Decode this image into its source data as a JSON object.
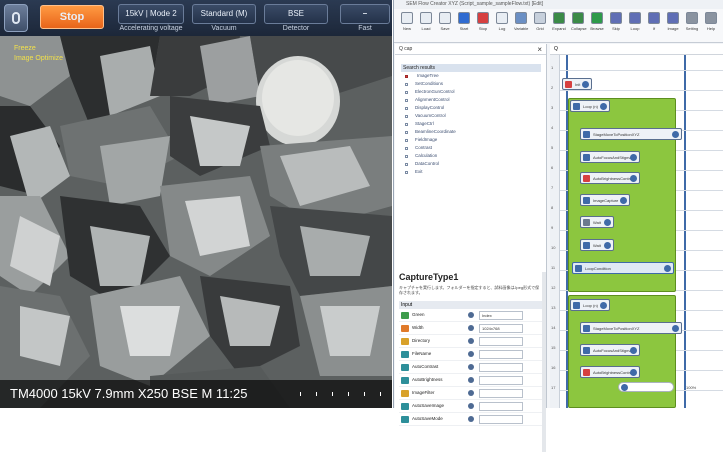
{
  "sem": {
    "stop_label": "Stop",
    "accel": {
      "value": "15kV | Mode 2",
      "caption": "Accelerating voltage"
    },
    "vacuum": {
      "value": "Standard (M)",
      "caption": "Vacuum"
    },
    "detector": {
      "value": "BSE",
      "caption": "Detector"
    },
    "scan": {
      "value": "–",
      "caption": "Fast"
    },
    "overlay_freeze": "Freeze",
    "overlay_optimize": "Image Optimize",
    "status": "TM4000 15kV 7.9mm X250 BSE M 11:25"
  },
  "flow": {
    "window_title": "SEM Flow Creator  XYZ  (Script_sample_sampleFlow.txt) [Edit]",
    "ribbon": [
      {
        "label": "New",
        "icon": "new-file-icon",
        "color": "#e8edf3"
      },
      {
        "label": "Load",
        "icon": "open-icon",
        "color": "#e8edf3"
      },
      {
        "label": "Save",
        "icon": "save-icon",
        "color": "#e8edf3"
      },
      {
        "label": "Start",
        "icon": "play-icon",
        "color": "#2f6bd1"
      },
      {
        "label": "Stop",
        "icon": "stop-icon",
        "color": "#d64040"
      },
      {
        "label": "Log",
        "icon": "log-icon",
        "color": "#e8edf3"
      },
      {
        "label": "Variable",
        "icon": "variable-icon",
        "color": "#6b8fc4"
      },
      {
        "label": "Grid",
        "icon": "grid-icon",
        "color": "#c7d0dc"
      },
      {
        "label": "Expand",
        "icon": "expand-icon",
        "color": "#3b8a47"
      },
      {
        "label": "Collapse",
        "icon": "collapse-icon",
        "color": "#3b8a47"
      },
      {
        "label": "Browse",
        "icon": "browse-icon",
        "color": "#2e9a4a"
      },
      {
        "label": "Skip",
        "icon": "skip-icon",
        "color": "#5f6eb5"
      },
      {
        "label": "Loop",
        "icon": "loop-icon",
        "color": "#5f6eb5"
      },
      {
        "label": "If",
        "icon": "if-icon",
        "color": "#5f6eb5"
      },
      {
        "label": "Image",
        "icon": "image-icon",
        "color": "#5f6eb5"
      },
      {
        "label": "Setting",
        "icon": "gear-icon",
        "color": "#8a93a0"
      },
      {
        "label": "Help",
        "icon": "help-icon",
        "color": "#8a93a0"
      }
    ],
    "search_text": "Q cap",
    "tree_head": "Search results",
    "tree_items": [
      "ImageTree",
      "SetConditions",
      "ElectronGunControl",
      "AlignmentControl",
      "DisplayControl",
      "VacuumControl",
      "StageCtrl",
      "BeamlineCoordinate",
      "FieldImage",
      "Contrast",
      "Calculation",
      "DataControl",
      "Exit"
    ],
    "props": {
      "title": "CaptureType1",
      "desc": "キャプチャを実行します。フォルダーを指定すると、試料画像はJpeg形式で保存されます。",
      "input_head": "Input",
      "rows": [
        {
          "label": "Green",
          "value": "Index",
          "color": "#3d9c4b"
        },
        {
          "label": "Width",
          "value": "1024x768",
          "color": "#e07a2a"
        },
        {
          "label": "Directory",
          "value": "",
          "color": "#d8a12a"
        },
        {
          "label": "FileName",
          "value": "",
          "color": "#2d8f9a"
        },
        {
          "label": "AutoContrast",
          "value": "",
          "color": "#2d8f9a"
        },
        {
          "label": "AutoBrightness",
          "value": "",
          "color": "#2d8f9a"
        },
        {
          "label": "ImageFilter",
          "value": "",
          "color": "#d8a12a"
        },
        {
          "label": "AutoSaveImage",
          "value": "",
          "color": "#2d8f9a"
        },
        {
          "label": "AutoSaveMode",
          "value": "",
          "color": "#2d8f9a"
        }
      ]
    },
    "canvas_search": "Q",
    "ruler_numbers": [
      "1",
      "2",
      "3",
      "4",
      "5",
      "6",
      "7",
      "8",
      "9",
      "10",
      "11",
      "12",
      "13",
      "14",
      "15",
      "16",
      "17"
    ],
    "nodes": [
      {
        "label": "Init",
        "color": "#d64040"
      },
      {
        "label": "Loop (n)",
        "color": "#3f6aa8"
      },
      {
        "label": "StageMoveToPositionXYZ",
        "color": "#3f6aa8"
      },
      {
        "label": "AutoFocusAndStigma",
        "color": "#3f6aa8"
      },
      {
        "label": "AutoBrightnessContrast",
        "color": "#d64040"
      },
      {
        "label": "ImageCapture",
        "color": "#3f6aa8"
      },
      {
        "label": "Wait",
        "color": "#6b7a8f"
      },
      {
        "label": "Wait",
        "color": "#3f6aa8"
      },
      {
        "label": "LoopCondition",
        "color": "#3f6aa8"
      },
      {
        "label": "Loop (n)",
        "color": "#3f6aa8"
      },
      {
        "label": "StageMoveToPositionXYZ",
        "color": "#3f6aa8"
      },
      {
        "label": "AutoFocusAndStigma",
        "color": "#3f6aa8"
      },
      {
        "label": "AutoBrightnessContrast",
        "color": "#d64040"
      }
    ],
    "zoom_label": "100%"
  }
}
